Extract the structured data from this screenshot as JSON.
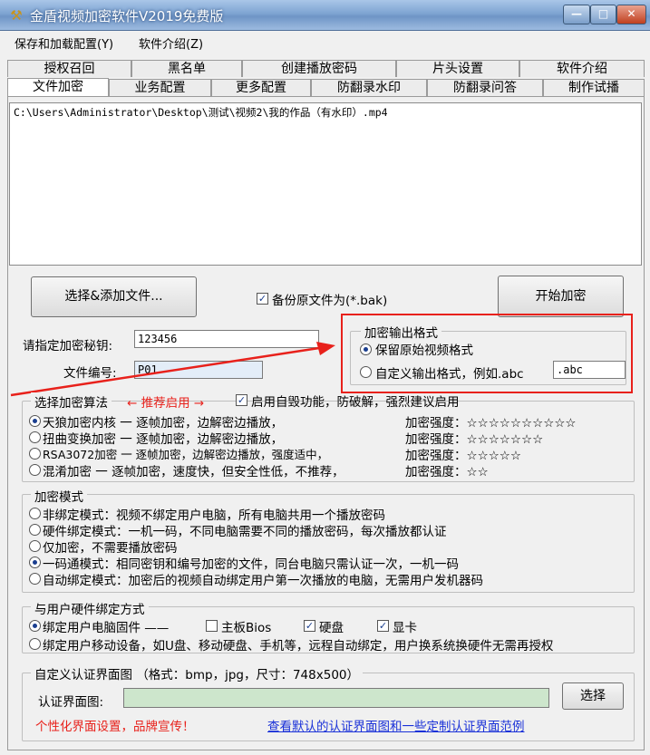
{
  "window": {
    "title": "金盾视频加密软件V2019免费版",
    "minimize": "—",
    "maximize": "□",
    "close": "✕",
    "app_icon": "⚒"
  },
  "menu": [
    "保存和加载配置(Y)",
    "软件介绍(Z)"
  ],
  "tabs_row1": [
    "授权召回",
    "黑名单",
    "创建播放密码",
    "片头设置",
    "软件介绍"
  ],
  "tabs_row2": [
    "文件加密",
    "业务配置",
    "更多配置",
    "防翻录水印",
    "防翻录问答",
    "制作试播"
  ],
  "active_tab": "文件加密",
  "file_path": "C:\\Users\\Administrator\\Desktop\\测试\\视频2\\我的作品（有水印）.mp4",
  "select_file_button": "选择&添加文件...",
  "backup": {
    "label": "备份原文件为(*.bak)",
    "checked": true
  },
  "start_button": "开始加密",
  "key": {
    "label": "请指定加密秘钥:",
    "value": "123456"
  },
  "file_id": {
    "label": "文件编号:",
    "value": "P01"
  },
  "output_format": {
    "title": "加密输出格式",
    "keep": "保留原始视频格式",
    "custom": "自定义输出格式，例如.abc",
    "custom_value": ".abc"
  },
  "algorithm": {
    "title": "选择加密算法",
    "recommend": "← 推荐启用 →",
    "self_destruct": "启用自毁功能，防破解，强烈建议启用",
    "options": [
      {
        "name": "天狼加密内核 一 逐帧加密，边解密边播放，",
        "strength": "加密强度：☆☆☆☆☆☆☆☆☆☆",
        "selected": true
      },
      {
        "name": "扭曲变换加密 一 逐帧加密，边解密边播放，",
        "strength": "加密强度：☆☆☆☆☆☆☆",
        "selected": false
      },
      {
        "name": "RSA3072加密 一  逐帧加密，边解密边播放，强度适中，",
        "strength": "加密强度：☆☆☆☆☆",
        "selected": false
      },
      {
        "name": "混淆加密 一 逐帧加密，速度快，但安全性低，不推荐，",
        "strength": "加密强度：☆☆",
        "selected": false
      }
    ]
  },
  "mode": {
    "title": "加密模式",
    "options": [
      {
        "label": "非绑定模式：视频不绑定用户电脑，所有电脑共用一个播放密码",
        "selected": false
      },
      {
        "label": "硬件绑定模式：一机一码，不同电脑需要不同的播放密码，每次播放都认证",
        "selected": false
      },
      {
        "label": "仅加密，不需要播放密码",
        "selected": false
      },
      {
        "label": "一码通模式：相同密钥和编号加密的文件，同台电脑只需认证一次，一机一码",
        "selected": true
      },
      {
        "label": "自动绑定模式：加密后的视频自动绑定用户第一次播放的电脑，无需用户发机器码",
        "selected": false
      }
    ]
  },
  "binding": {
    "title": "与用户硬件绑定方式",
    "opt1": "绑定用户电脑固件 ——",
    "board": {
      "label": "主板Bios",
      "checked": false
    },
    "disk": {
      "label": "硬盘",
      "checked": true
    },
    "gpu": {
      "label": "显卡",
      "checked": true
    },
    "opt2": "绑定用户移动设备，如U盘、移动硬盘、手机等，远程自动绑定，用户换系统换硬件无需再授权"
  },
  "custom_ui": {
    "title": "自定义认证界面图 （格式：bmp，jpg，尺寸：748x500）",
    "label": "认证界面图:",
    "select_button": "选择",
    "promo": "个性化界面设置，品牌宣传！",
    "link": "查看默认的认证界面图和一些定制认证界面范例"
  },
  "colors": {
    "accent_red": "#e8211b",
    "link_blue": "#1a31d8",
    "input_green": "#cde6cc"
  }
}
